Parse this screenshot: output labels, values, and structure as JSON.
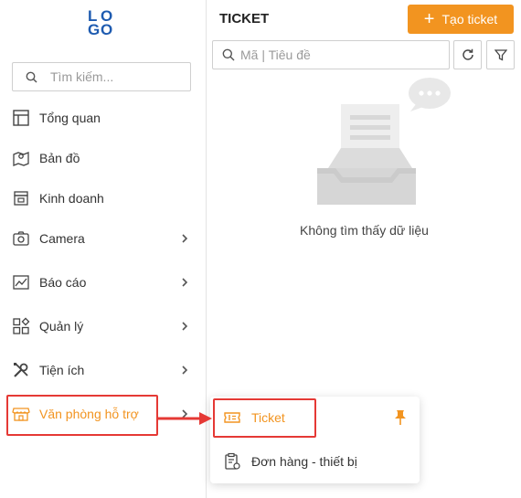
{
  "app": {
    "logo_letters": [
      "L",
      "O",
      "G",
      "O"
    ],
    "brand_color": "#1e5bb0",
    "accent_color": "#f29420",
    "highlight_color": "#e53935"
  },
  "sidebar": {
    "search": {
      "placeholder": "Tìm kiếm...",
      "icon": "search-icon"
    },
    "items": [
      {
        "label": "Tổng quan",
        "icon": "dashboard-icon",
        "has_submenu": false
      },
      {
        "label": "Bản đồ",
        "icon": "map-icon",
        "has_submenu": false
      },
      {
        "label": "Kinh doanh",
        "icon": "store-icon",
        "has_submenu": false
      },
      {
        "label": "Camera",
        "icon": "camera-icon",
        "has_submenu": true
      },
      {
        "label": "Báo cáo",
        "icon": "report-chart-icon",
        "has_submenu": true
      },
      {
        "label": "Quản lý",
        "icon": "apps-icon",
        "has_submenu": true
      },
      {
        "label": "Tiện ích",
        "icon": "tools-icon",
        "has_submenu": true
      },
      {
        "label": "Văn phòng hỗ trợ",
        "icon": "shop-icon",
        "has_submenu": true,
        "active": true
      }
    ]
  },
  "main": {
    "title": "TICKET",
    "create_button": {
      "label": "Tạo ticket",
      "icon": "plus-icon"
    },
    "search": {
      "placeholder": "Mã | Tiêu đề",
      "icon": "search-icon"
    },
    "refresh_icon": "refresh-icon",
    "filter_icon": "filter-icon",
    "empty": {
      "message": "Không tìm thấy dữ liệu",
      "icon": "empty-inbox-icon"
    }
  },
  "submenu": {
    "items": [
      {
        "label": "Ticket",
        "icon": "ticket-icon",
        "active": true,
        "pinned": true
      },
      {
        "label": "Đơn hàng - thiết bị",
        "icon": "clipboard-device-icon",
        "active": false
      }
    ]
  }
}
